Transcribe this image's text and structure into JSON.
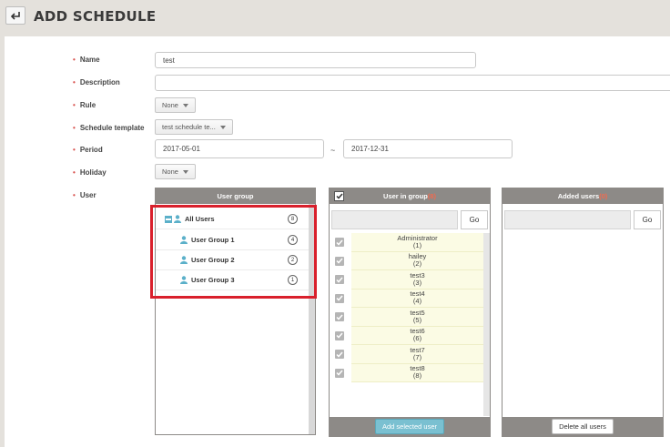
{
  "header": {
    "title": "ADD SCHEDULE",
    "back_icon": "return-arrow-icon"
  },
  "form": {
    "name": {
      "label": "Name",
      "value": "test"
    },
    "description": {
      "label": "Description",
      "value": ""
    },
    "rule": {
      "label": "Rule",
      "value": "None"
    },
    "schedule_template": {
      "label": "Schedule template",
      "value": "test schedule te..."
    },
    "period": {
      "label": "Period",
      "start": "2017-05-01",
      "separator": "~",
      "end": "2017-12-31"
    },
    "holiday": {
      "label": "Holiday",
      "value": "None"
    },
    "user": {
      "label": "User"
    }
  },
  "user_group": {
    "title": "User group",
    "items": [
      {
        "label": "All Users",
        "count": "8"
      },
      {
        "label": "User Group 1",
        "count": "4"
      },
      {
        "label": "User Group 2",
        "count": "2"
      },
      {
        "label": "User Group 3",
        "count": "1"
      }
    ]
  },
  "users_in_group": {
    "title": "User in group",
    "count": "(8)",
    "go_label": "Go",
    "users": [
      {
        "name": "Administrator",
        "id": "(1)"
      },
      {
        "name": "hailey",
        "id": "(2)"
      },
      {
        "name": "test3",
        "id": "(3)"
      },
      {
        "name": "test4",
        "id": "(4)"
      },
      {
        "name": "test5",
        "id": "(5)"
      },
      {
        "name": "test6",
        "id": "(6)"
      },
      {
        "name": "test7",
        "id": "(7)"
      },
      {
        "name": "test8",
        "id": "(8)"
      }
    ],
    "add_button": "Add selected user"
  },
  "added_users": {
    "title": "Added users",
    "count": "(0)",
    "go_label": "Go",
    "delete_button": "Delete all users"
  },
  "colors": {
    "accent": "#7ac0d1",
    "header_gray": "#8d8a87",
    "required": "#d9534f",
    "highlight": "#d9202c",
    "count": "#f26a4f"
  }
}
